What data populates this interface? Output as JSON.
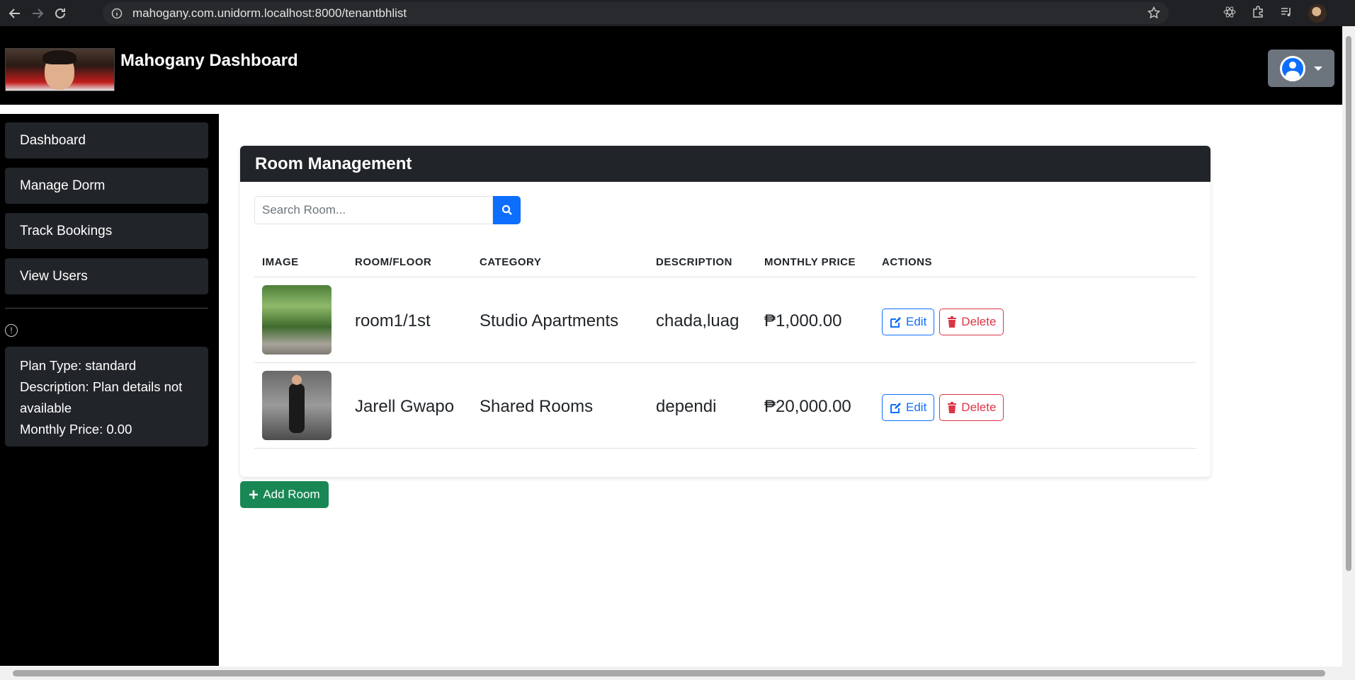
{
  "browser": {
    "url": "mahogany.com.unidorm.localhost:8000/tenantbhlist"
  },
  "header": {
    "title": "Mahogany Dashboard"
  },
  "sidebar": {
    "items": [
      {
        "label": "Dashboard"
      },
      {
        "label": "Manage Dorm"
      },
      {
        "label": "Track Bookings"
      },
      {
        "label": "View Users"
      }
    ],
    "plan": {
      "type_line": "Plan Type: standard",
      "description_line": "Description: Plan details not available",
      "price_line": "Monthly Price: 0.00"
    }
  },
  "main": {
    "card_title": "Room Management",
    "search": {
      "placeholder": "Search Room...",
      "value": ""
    },
    "table": {
      "columns": [
        "IMAGE",
        "ROOM/FLOOR",
        "CATEGORY",
        "DESCRIPTION",
        "MONTHLY PRICE",
        "ACTIONS"
      ],
      "rows": [
        {
          "room": "room1/1st",
          "category": "Studio Apartments",
          "description": "chada,luag",
          "price": "₱1,000.00",
          "edit": "Edit",
          "delete": "Delete"
        },
        {
          "room": "Jarell Gwapo",
          "category": "Shared Rooms",
          "description": "dependi",
          "price": "₱20,000.00",
          "edit": "Edit",
          "delete": "Delete"
        }
      ]
    },
    "add_button": "Add Room"
  },
  "colors": {
    "primary": "#0d6efd",
    "danger": "#dc3545",
    "success": "#198754",
    "dark": "#212529"
  }
}
